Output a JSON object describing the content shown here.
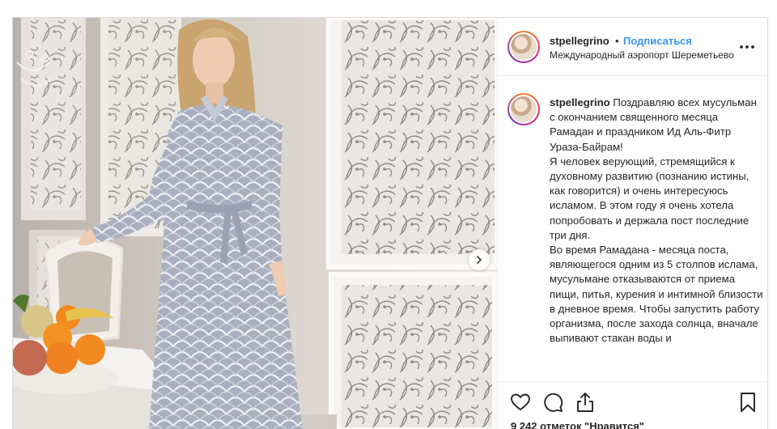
{
  "post": {
    "username": "stpellegrino",
    "separator": "•",
    "follow_label": "Подписаться",
    "location": "Международный аэропорт Шереметьево",
    "more_icon": "more-horizontal-icon"
  },
  "caption": {
    "username": "stpellegrino",
    "text": "Поздравляю всех мусульман с окончанием священного месяца Рамадан и праздником Ид Аль-Фитр Ураза-Байрам!\nЯ человек верующий, стремящийся к духовному развитию (познанию истины, как говорится) и очень интересуюсь исламом. В этом году я очень хотела попробовать и держала пост последние три дня.\nВо время Рамадана - месяца поста, являющегося одним из 5 столпов ислама, мусульмане отказываются от приема пищи, питья, курения и интимной близости в дневное время. Чтобы запустить работу организма, после захода солнца, вначале выпивают стакан воды и"
  },
  "actions": {
    "like_icon": "heart-icon",
    "comment_icon": "comment-icon",
    "share_icon": "share-icon",
    "save_icon": "bookmark-icon",
    "likes_text": "9 242 отметок \"Нравится\""
  },
  "carousel": {
    "next_icon": "chevron-right-icon"
  },
  "colors": {
    "link": "#3897f0",
    "text": "#262626",
    "border": "#efefef"
  }
}
